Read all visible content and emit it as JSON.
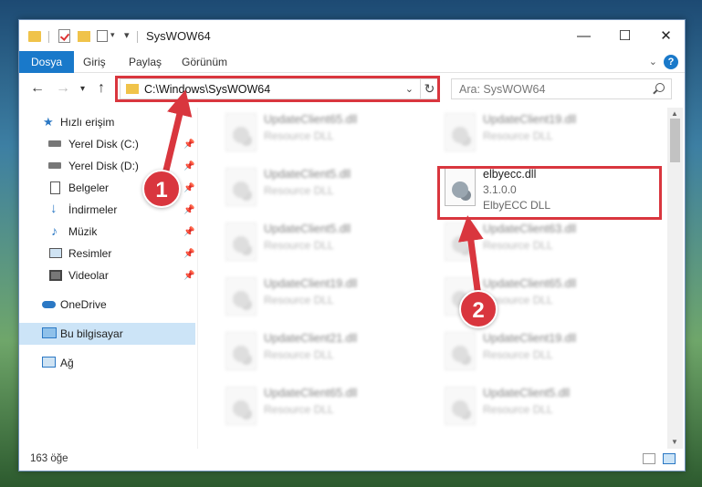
{
  "window": {
    "title": "SysWOW64",
    "controls": {
      "minimize": "—",
      "maximize": "☐",
      "close": "✕"
    }
  },
  "ribbon": {
    "tabs": [
      "Dosya",
      "Giriş",
      "Paylaş",
      "Görünüm"
    ],
    "help": "?"
  },
  "address": {
    "path": "C:\\Windows\\SysWOW64",
    "search_placeholder": "Ara: SysWOW64"
  },
  "sidebar": {
    "items": [
      {
        "label": "Hızlı erişim",
        "icon": "star-icon"
      },
      {
        "label": "Yerel Disk (C:)",
        "icon": "drive-icon",
        "pinned": true
      },
      {
        "label": "Yerel Disk (D:)",
        "icon": "drive-icon",
        "pinned": true
      },
      {
        "label": "Belgeler",
        "icon": "documents-icon",
        "pinned": true
      },
      {
        "label": "İndirmeler",
        "icon": "download-icon",
        "pinned": true
      },
      {
        "label": "Müzik",
        "icon": "music-icon",
        "pinned": true
      },
      {
        "label": "Resimler",
        "icon": "pictures-icon",
        "pinned": true
      },
      {
        "label": "Videolar",
        "icon": "video-icon",
        "pinned": true
      },
      {
        "label": "OneDrive",
        "icon": "cloud-icon"
      },
      {
        "label": "Bu bilgisayar",
        "icon": "computer-icon",
        "selected": true
      },
      {
        "label": "Ağ",
        "icon": "network-icon"
      }
    ]
  },
  "files": {
    "left": [
      {
        "name": "UpdateClient65.dll",
        "desc": "Resource DLL"
      },
      {
        "name": "UpdateClient5.dll",
        "desc": "Resource DLL"
      },
      {
        "name": "UpdateClient5.dll",
        "desc": "Resource DLL"
      },
      {
        "name": "UpdateClient19.dll",
        "desc": "Resource DLL"
      },
      {
        "name": "UpdateClient21.dll",
        "desc": "Resource DLL"
      },
      {
        "name": "UpdateClient65.dll",
        "desc": "Resource DLL"
      }
    ],
    "right": [
      {
        "name": "UpdateClient19.dll",
        "desc": "Resource DLL"
      },
      {
        "name": "elbyecc.dll",
        "desc": "3.1.0.0",
        "desc2": "ElbyECC DLL",
        "highlight": true
      },
      {
        "name": "UpdateClient63.dll",
        "desc": "Resource DLL"
      },
      {
        "name": "UpdateClient65.dll",
        "desc": "Resource DLL"
      },
      {
        "name": "UpdateClient19.dll",
        "desc": "Resource DLL"
      },
      {
        "name": "UpdateClient5.dll",
        "desc": "Resource DLL"
      }
    ]
  },
  "status": {
    "count": "163 öğe"
  },
  "annotations": {
    "step1": "1",
    "step2": "2"
  },
  "colors": {
    "accent": "#1979ca",
    "highlight": "#d9363e"
  }
}
